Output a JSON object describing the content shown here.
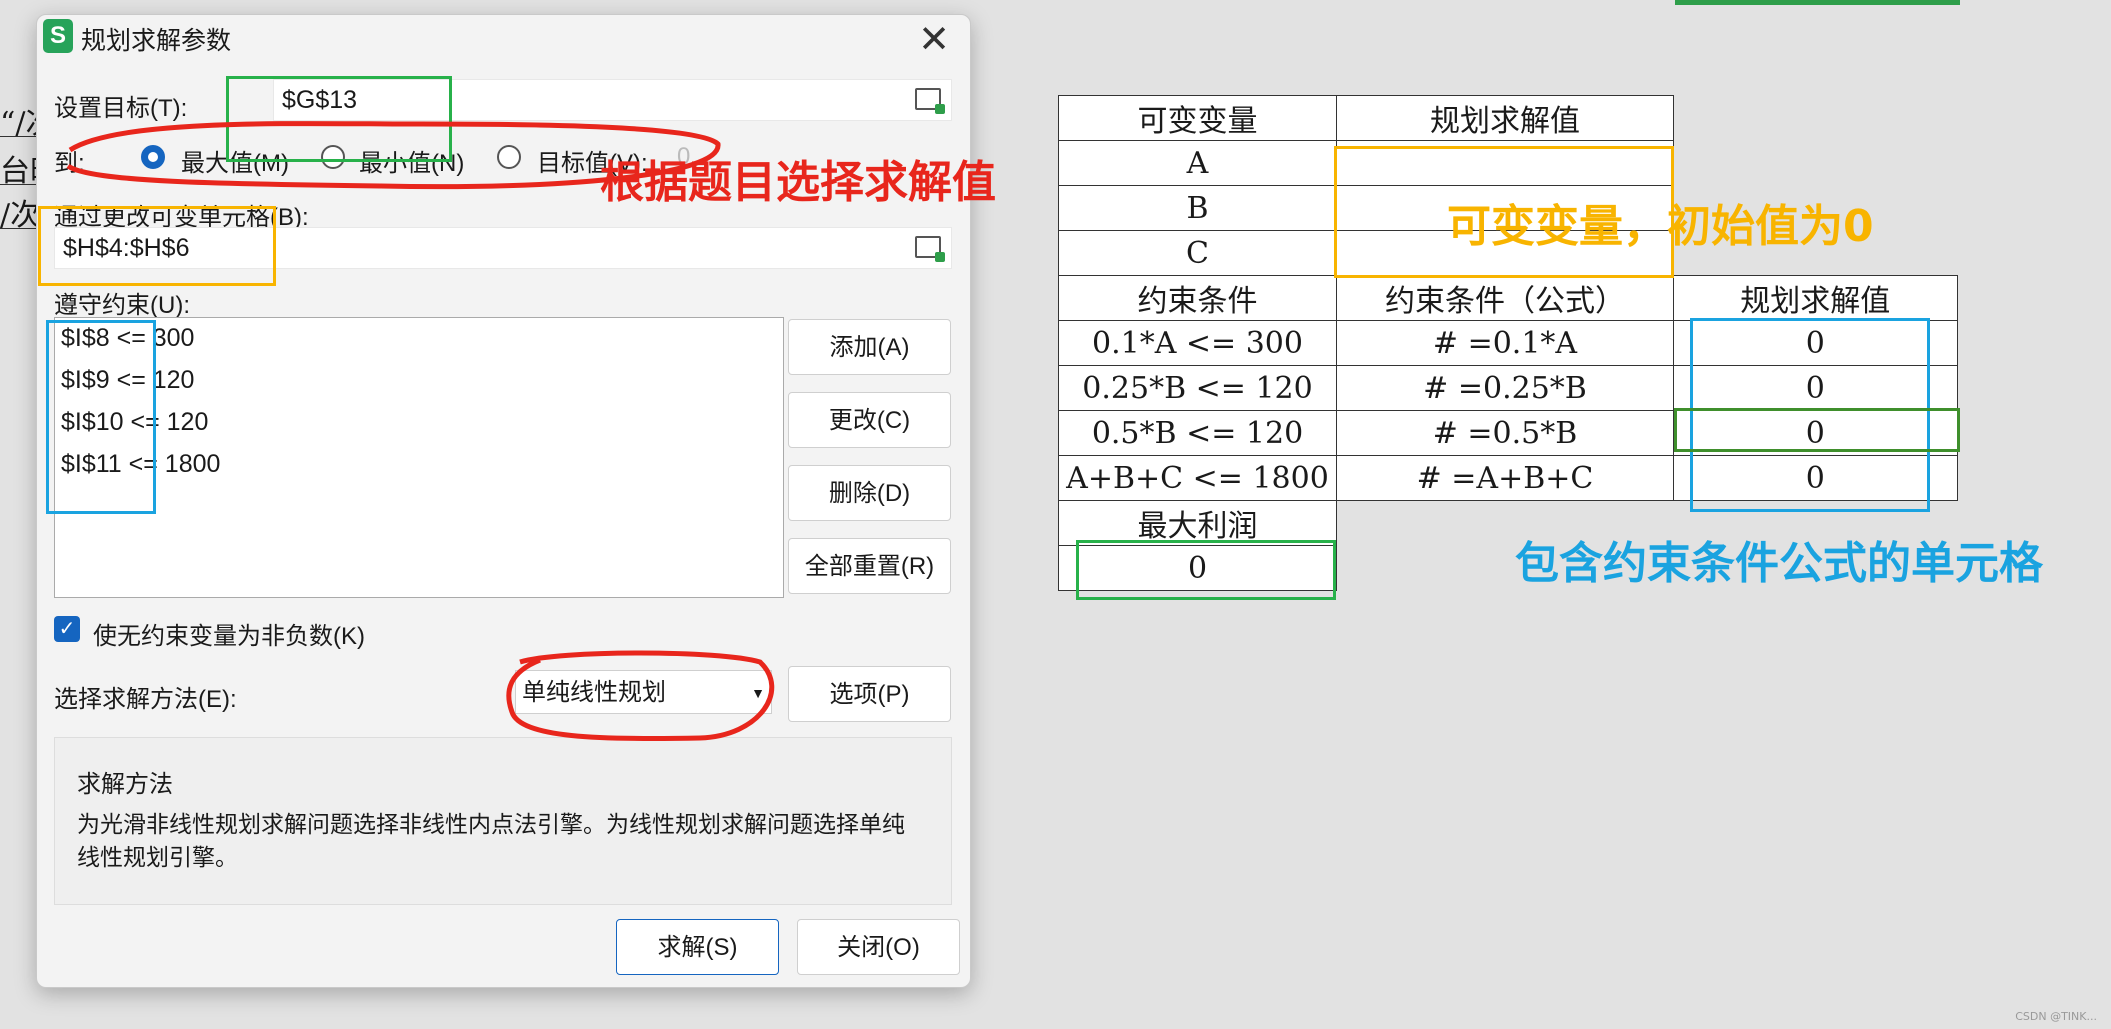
{
  "sheet": {
    "left_fragments": [
      "“/次",
      "台时",
      "/次"
    ],
    "table": {
      "header1": [
        "可变变量",
        "规划求解值"
      ],
      "vars": [
        "A",
        "B",
        "C"
      ],
      "header2": [
        "约束条件",
        "约束条件（公式）",
        "规划求解值"
      ],
      "constraints": [
        {
          "cond": "0.1*A <= 300",
          "formula": "# =0.1*A",
          "value": "0"
        },
        {
          "cond": "0.25*B <= 120",
          "formula": "# =0.25*B",
          "value": "0"
        },
        {
          "cond": "0.5*B <= 120",
          "formula": "# =0.5*B",
          "value": "0"
        },
        {
          "cond": "A+B+C <= 1800",
          "formula": "# =A+B+C",
          "value": "0"
        }
      ],
      "profit_label": "最大利润",
      "profit_value": "0"
    },
    "annotations": {
      "select_value": "根据题目选择求解值",
      "variables": "可变变量，初始值为0",
      "constraints": "包含约束条件公式的单元格"
    },
    "colors": {
      "red": "#e8261c",
      "orange": "#f8b400",
      "blue": "#1aa3e0",
      "green": "#27b14a"
    },
    "watermark": "CSDN @TINK..."
  },
  "dialog": {
    "title": "规划求解参数",
    "icon": "S",
    "objective_label": "设置目标(T):",
    "objective_value": "$G$13",
    "to_label": "到:",
    "options": [
      {
        "label": "最大值(M)",
        "selected": true
      },
      {
        "label": "最小值(N)",
        "selected": false
      },
      {
        "label": "目标值(V):",
        "selected": false
      }
    ],
    "target_value": "0",
    "change_label": "通过更改可变单元格(B):",
    "change_value": "$H$4:$H$6",
    "constraints_label": "遵守约束(U):",
    "constraints": [
      "$I$8 <= 300",
      "$I$9 <= 120",
      "$I$10 <= 120",
      "$I$11 <= 1800"
    ],
    "buttons": {
      "add": "添加(A)",
      "change": "更改(C)",
      "delete": "删除(D)",
      "reset": "全部重置(R)",
      "options": "选项(P)",
      "solve": "求解(S)",
      "close": "关闭(O)"
    },
    "nonneg_label": "使无约束变量为非负数(K)",
    "nonneg_checked": true,
    "method_label": "选择求解方法(E):",
    "method_value": "单纯线性规划",
    "method_heading": "求解方法",
    "method_desc": "为光滑非线性规划求解问题选择非线性内点法引擎。为线性规划求解问题选择单纯线性规划引擎。"
  }
}
